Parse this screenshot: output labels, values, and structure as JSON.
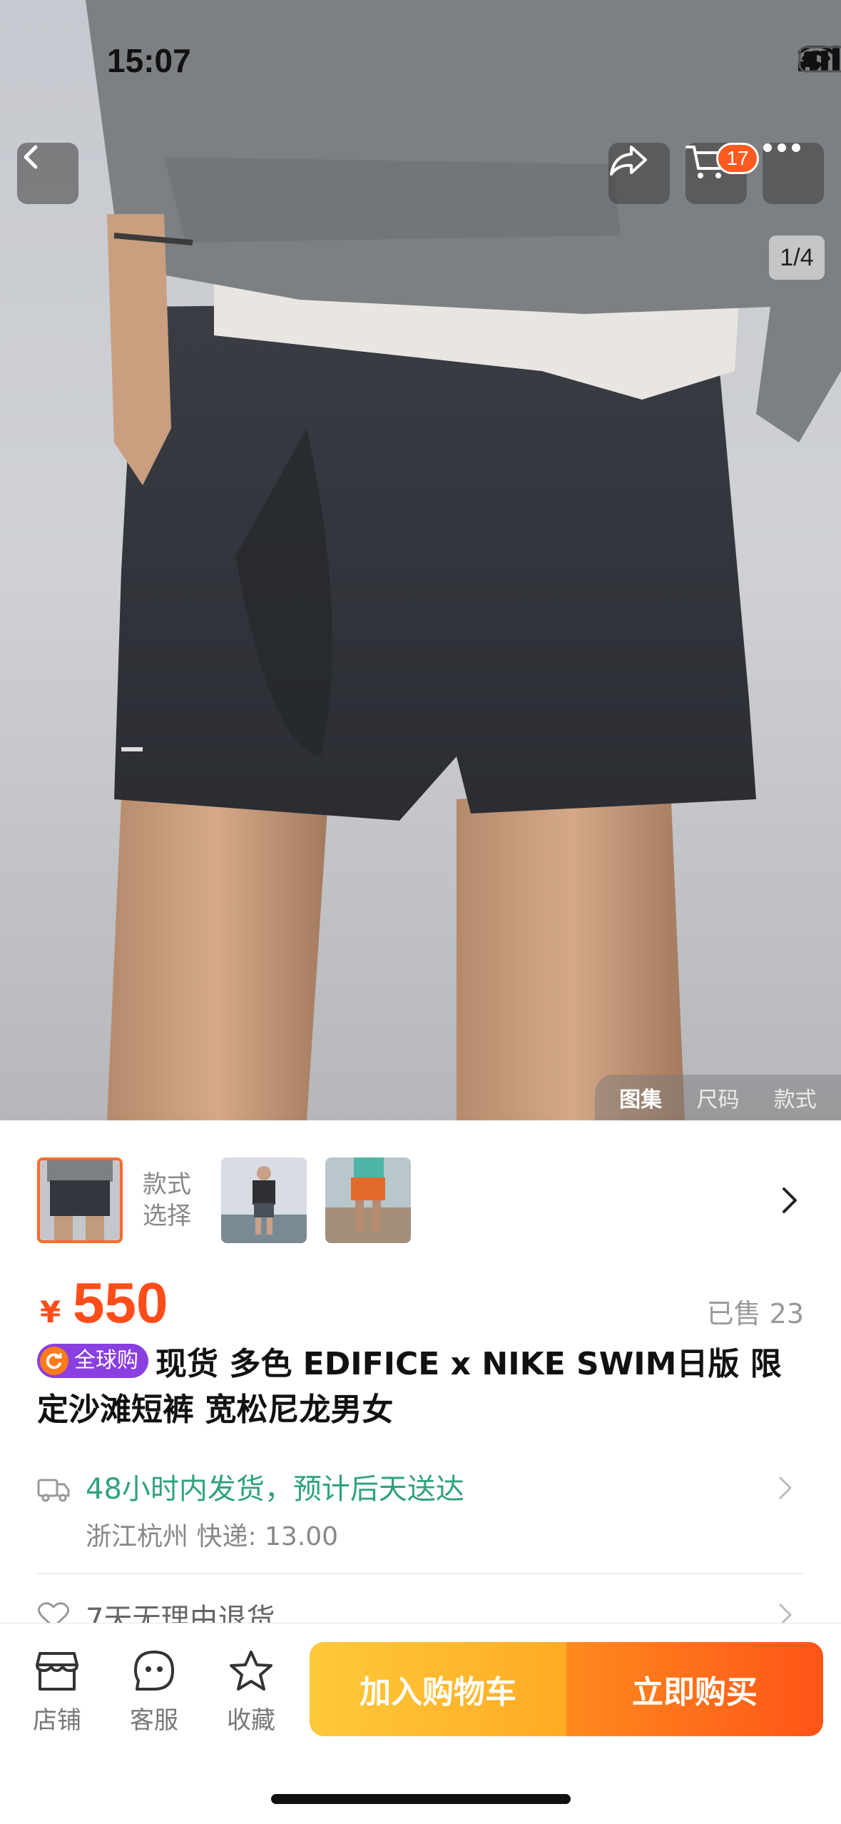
{
  "status_bar": {
    "time": "15:07"
  },
  "header": {
    "cart_count": "17",
    "page_indicator": "1/4"
  },
  "gallery_tabs": [
    "图集",
    "尺码",
    "款式"
  ],
  "variants": {
    "label": "款式选择"
  },
  "price": {
    "currency": "¥",
    "value": "550",
    "sold": "已售 23"
  },
  "title": {
    "badge": "全球购",
    "text": "现货 多色 EDIFICE x NIKE SWIM日版  限定沙滩短裤 宽松尼龙男女"
  },
  "shipping": {
    "main": "48小时内发货，预计后天送达",
    "sub": "浙江杭州  快递: 13.00"
  },
  "returns": {
    "text": "7天无理由退货"
  },
  "bottom_bar": {
    "store": "店铺",
    "service": "客服",
    "favorite": "收藏",
    "add_to_cart": "加入购物车",
    "buy_now": "立即购买"
  },
  "colors": {
    "accent": "#ff5417",
    "price": "#ff4d1a",
    "shipping": "#2fa37a",
    "cart_button": "#ffb52a"
  }
}
